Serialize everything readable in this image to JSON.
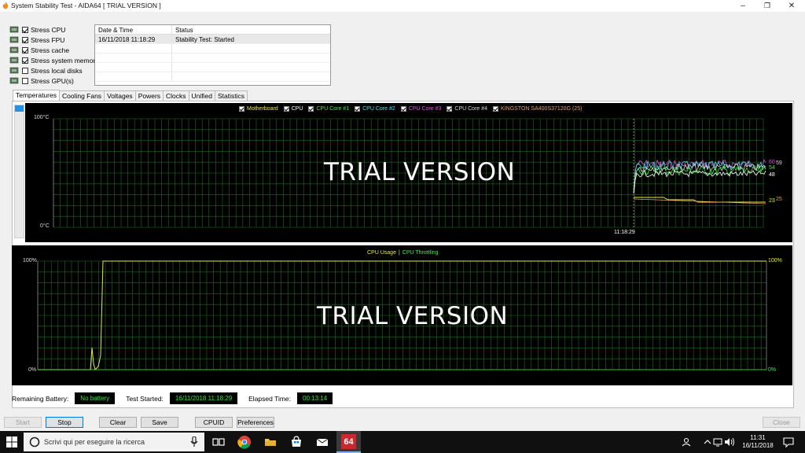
{
  "window": {
    "title": "System Stability Test - AIDA64  [ TRIAL VERSION ]"
  },
  "stress_options": [
    {
      "label": "Stress CPU",
      "checked": true,
      "icon": "cpu-icon"
    },
    {
      "label": "Stress FPU",
      "checked": true,
      "icon": "fpu-icon"
    },
    {
      "label": "Stress cache",
      "checked": true,
      "icon": "cache-icon"
    },
    {
      "label": "Stress system memory",
      "checked": true,
      "icon": "memory-icon"
    },
    {
      "label": "Stress local disks",
      "checked": false,
      "icon": "disk-icon"
    },
    {
      "label": "Stress GPU(s)",
      "checked": false,
      "icon": "gpu-icon"
    }
  ],
  "log": {
    "headers": [
      "Date & Time",
      "Status"
    ],
    "rows": [
      {
        "datetime": "16/11/2018 11:18:29",
        "status": "Stability Test: Started"
      }
    ]
  },
  "tabs": [
    "Temperatures",
    "Cooling Fans",
    "Voltages",
    "Powers",
    "Clocks",
    "Unified",
    "Statistics"
  ],
  "temperature_graph": {
    "legend": [
      {
        "label": "Motherboard",
        "color": "#e8e84a"
      },
      {
        "label": "CPU",
        "color": "#ffffff"
      },
      {
        "label": "CPU Core #1",
        "color": "#3ef03e"
      },
      {
        "label": "CPU Core #2",
        "color": "#3ee8e8"
      },
      {
        "label": "CPU Core #3",
        "color": "#e84ae8"
      },
      {
        "label": "CPU Core #4",
        "color": "#d8d8d8"
      },
      {
        "label": "KINGSTON SA400S37120G (25)",
        "color": "#e8a060"
      }
    ],
    "y_top": "100°C",
    "y_bottom": "0°C",
    "x_label": "11:18:29",
    "watermark": "TRIAL VERSION",
    "value_labels": [
      "60",
      "59",
      "54",
      "48",
      "23",
      "25"
    ]
  },
  "usage_graph": {
    "legend": [
      {
        "label": "CPU Usage",
        "color": "#e8e84a"
      },
      {
        "label": "CPU Throttling",
        "color": "#3ef03e"
      }
    ],
    "separator": "|",
    "y_top_left": "100%",
    "y_bottom_left": "0%",
    "y_top_right": "100%",
    "y_bottom_right": "0%",
    "watermark": "TRIAL VERSION"
  },
  "status_bar": {
    "battery_label": "Remaining Battery:",
    "battery_value": "No battery",
    "started_label": "Test Started:",
    "started_value": "16/11/2018 11:18:29",
    "elapsed_label": "Elapsed Time:",
    "elapsed_value": "00:13:14"
  },
  "buttons": {
    "start": "Start",
    "stop": "Stop",
    "clear": "Clear",
    "save": "Save",
    "cpuid": "CPUID",
    "preferences": "Preferences",
    "close": "Close"
  },
  "taskbar": {
    "search_placeholder": "Scrivi qui per eseguire la ricerca",
    "time": "11:31",
    "date": "16/11/2018",
    "aida_label": "64"
  },
  "colors": {
    "grid": "#1e6e1e",
    "accent": "#0078d7",
    "info_text": "#3fe03f"
  }
}
